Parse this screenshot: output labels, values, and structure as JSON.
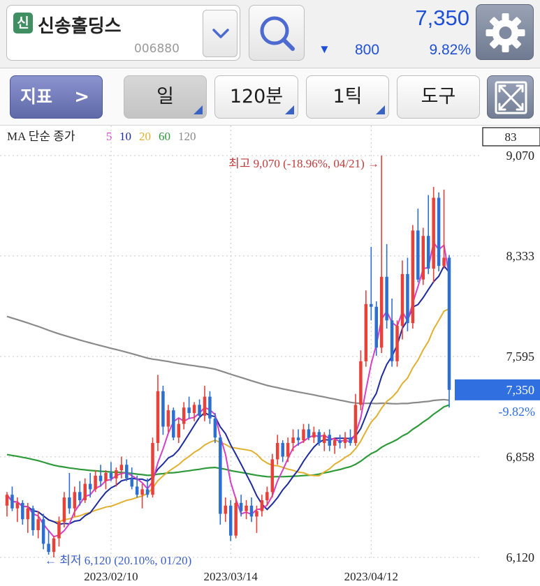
{
  "header": {
    "badge": "신",
    "stock_name": "신송홀딩스",
    "stock_code": "006880",
    "price": "7,350",
    "change_arrow": "▼",
    "change_amount": "800",
    "change_percent": "9.82%",
    "colors": {
      "down": "#1f4fd6",
      "badge": "#3f8f63"
    },
    "icons": {
      "dropdown": "chevron-down-icon",
      "search": "search-icon",
      "settings": "gear-icon"
    }
  },
  "toolbar": {
    "indicator_label": "지표",
    "indicator_chevron": ">",
    "period_label": "일",
    "minute_label": "120분",
    "tick_label": "1틱",
    "tools_label": "도구",
    "expand_icon": "expand-icon"
  },
  "chart_data": {
    "type": "candlestick",
    "ma_legend": {
      "prefix": "MA 단순 종가",
      "periods": [
        {
          "label": "5",
          "color": "#d63fc6"
        },
        {
          "label": "10",
          "color": "#1d2aa0"
        },
        {
          "label": "20",
          "color": "#e0b030"
        },
        {
          "label": "60",
          "color": "#2f9a3a"
        },
        {
          "label": "120",
          "color": "#8a8a8a"
        }
      ]
    },
    "ylim": [
      6120,
      9070
    ],
    "y_ticks": [
      "9,070",
      "8,333",
      "7,595",
      "6,858",
      "6,120"
    ],
    "y_tick_values": [
      9070,
      8333,
      7595,
      6858,
      6120
    ],
    "x_ticks": [
      "2023/02/10",
      "2023/03/14",
      "2023/04/12"
    ],
    "top_box_value": "83",
    "current_price_label": "7,350",
    "current_price": 7350,
    "current_change_label": "-9.82%",
    "high_annotation": "최고 9,070 (-18.96%, 04/21) →",
    "low_annotation": "← 최저 6,120 (20.10%, 01/20)",
    "colors": {
      "up": "#e8413a",
      "down": "#2d6fd0",
      "price_box": "#2f6fe0"
    },
    "candles": [
      [
        6500,
        6600,
        6420,
        6580
      ],
      [
        6580,
        6640,
        6460,
        6480
      ],
      [
        6480,
        6560,
        6380,
        6520
      ],
      [
        6520,
        6540,
        6360,
        6400
      ],
      [
        6400,
        6520,
        6300,
        6480
      ],
      [
        6480,
        6500,
        6280,
        6320
      ],
      [
        6320,
        6460,
        6260,
        6400
      ],
      [
        6400,
        6440,
        6180,
        6220
      ],
      [
        6220,
        6320,
        6140,
        6160
      ],
      [
        6160,
        6280,
        6120,
        6260
      ],
      [
        6260,
        6420,
        6200,
        6380
      ],
      [
        6380,
        6600,
        6340,
        6560
      ],
      [
        6560,
        6740,
        6440,
        6480
      ],
      [
        6480,
        6640,
        6420,
        6600
      ],
      [
        6600,
        6680,
        6500,
        6540
      ],
      [
        6540,
        6700,
        6520,
        6660
      ],
      [
        6660,
        6740,
        6560,
        6620
      ],
      [
        6620,
        6760,
        6600,
        6720
      ],
      [
        6720,
        6800,
        6640,
        6680
      ],
      [
        6680,
        6760,
        6620,
        6740
      ],
      [
        6740,
        6820,
        6680,
        6700
      ],
      [
        6700,
        6780,
        6640,
        6760
      ],
      [
        6760,
        6860,
        6700,
        6800
      ],
      [
        6800,
        6840,
        6680,
        6700
      ],
      [
        6700,
        6780,
        6620,
        6640
      ],
      [
        6640,
        6720,
        6560,
        6580
      ],
      [
        6580,
        6660,
        6480,
        6620
      ],
      [
        6620,
        6700,
        6560,
        6580
      ],
      [
        6580,
        7000,
        6560,
        6960
      ],
      [
        6960,
        7460,
        6900,
        7340
      ],
      [
        7340,
        7380,
        7020,
        7080
      ],
      [
        7080,
        7240,
        7040,
        7200
      ],
      [
        7200,
        7220,
        6980,
        7000
      ],
      [
        7000,
        7140,
        6960,
        7100
      ],
      [
        7100,
        7260,
        7060,
        7220
      ],
      [
        7220,
        7300,
        7140,
        7180
      ],
      [
        7180,
        7260,
        7120,
        7240
      ],
      [
        7240,
        7280,
        7140,
        7160
      ],
      [
        7160,
        7380,
        7120,
        7300
      ],
      [
        7300,
        7340,
        7100,
        7140
      ],
      [
        7140,
        7180,
        6960,
        7000
      ],
      [
        7000,
        7020,
        6360,
        6440
      ],
      [
        6440,
        6560,
        6380,
        6500
      ],
      [
        6500,
        6540,
        6240,
        6280
      ],
      [
        6280,
        6560,
        6260,
        6520
      ],
      [
        6520,
        6580,
        6420,
        6460
      ],
      [
        6460,
        6540,
        6400,
        6500
      ],
      [
        6500,
        6560,
        6380,
        6420
      ],
      [
        6420,
        6500,
        6300,
        6460
      ],
      [
        6460,
        6580,
        6420,
        6540
      ],
      [
        6540,
        6640,
        6500,
        6600
      ],
      [
        6600,
        6880,
        6560,
        6840
      ],
      [
        6840,
        7020,
        6800,
        6960
      ],
      [
        6960,
        6980,
        6820,
        6860
      ],
      [
        6860,
        7000,
        6820,
        6960
      ],
      [
        6960,
        7060,
        6900,
        7000
      ],
      [
        7000,
        7060,
        6940,
        6980
      ],
      [
        6980,
        7100,
        6960,
        7060
      ],
      [
        7060,
        7100,
        6980,
        7000
      ],
      [
        7000,
        7080,
        6960,
        7040
      ],
      [
        7040,
        7060,
        6940,
        6960
      ],
      [
        6960,
        7040,
        6900,
        7020
      ],
      [
        7020,
        7060,
        6900,
        6940
      ],
      [
        6940,
        7000,
        6880,
        6980
      ],
      [
        6980,
        7020,
        6920,
        6960
      ],
      [
        6960,
        7040,
        6920,
        7000
      ],
      [
        7000,
        7060,
        6940,
        6960
      ],
      [
        6960,
        7320,
        6940,
        7240
      ],
      [
        7240,
        7640,
        7200,
        7560
      ],
      [
        7560,
        8080,
        7520,
        7980
      ],
      [
        7980,
        8400,
        7860,
        7960
      ],
      [
        7960,
        8000,
        7600,
        7660
      ],
      [
        7660,
        9070,
        7620,
        8180
      ],
      [
        8180,
        8420,
        7800,
        7860
      ],
      [
        7860,
        8020,
        7520,
        7560
      ],
      [
        7560,
        7860,
        7520,
        7820
      ],
      [
        7820,
        8300,
        7720,
        8200
      ],
      [
        8200,
        8320,
        7780,
        7840
      ],
      [
        7840,
        8560,
        7800,
        8520
      ],
      [
        8520,
        8680,
        8140,
        8160
      ],
      [
        8160,
        8540,
        8120,
        8480
      ],
      [
        8480,
        8780,
        8200,
        8240
      ],
      [
        8240,
        8840,
        8140,
        8760
      ],
      [
        8760,
        8800,
        8220,
        8260
      ],
      [
        8260,
        8820,
        8240,
        8320
      ],
      [
        8320,
        8340,
        7220,
        7350
      ]
    ]
  }
}
